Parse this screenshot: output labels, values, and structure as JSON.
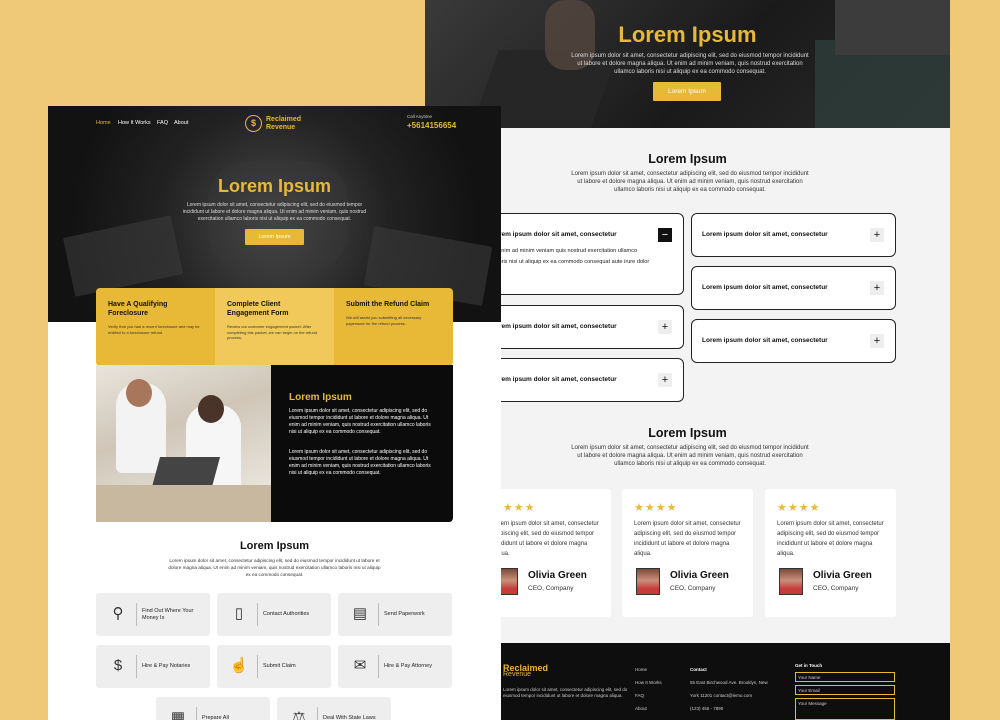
{
  "back": {
    "hero": {
      "title": "Lorem Ipsum",
      "text": "Lorem ipsum dolor sit amet, consectetur adipiscing elit, sed do eiusmod tempor incididunt ut labore et dolore magna aliqua. Ut enim ad minim veniam, quis nostrud exercitation ullamco laboris nisi ut aliquip ex ea commodo consequat.",
      "button": "Lorem Ipsum"
    },
    "faq_section": {
      "title": "Lorem Ipsum",
      "text": "Lorem ipsum dolor sit amet, consectetur adipiscing elit, sed do eiusmod tempor incididunt ut labore et dolore magna aliqua. Ut enim ad minim veniam, quis nostrud exercitation ullamco laboris nisi ut aliquip ex ea commodo consequat.",
      "items": [
        {
          "q": "Lorem ipsum dolor sit amet, consectetur",
          "toggle": "−",
          "answer": "Ut enim ad minim veniam quis nostrud exercitation ullamco laboris nisi ut aliquip ex ea commodo consequat aute irure dolor"
        },
        {
          "q": "Lorem ipsum dolor sit amet, consectetur",
          "toggle": "+"
        },
        {
          "q": "Lorem ipsum dolor sit amet, consectetur",
          "toggle": "+"
        },
        {
          "q": "Lorem ipsum dolor sit amet, consectetur",
          "toggle": "+"
        },
        {
          "q": "Lorem ipsum dolor sit amet, consectetur",
          "toggle": "+"
        },
        {
          "q": "Lorem ipsum dolor sit amet, consectetur",
          "toggle": "+"
        }
      ]
    },
    "testimonials": {
      "title": "Lorem Ipsum",
      "text": "Lorem ipsum dolor sit amet, consectetur adipiscing elit, sed do eiusmod tempor incididunt ut labore et dolore magna aliqua. Ut enim ad minim veniam, quis nostrud exercitation ullamco laboris nisi ut aliquip ex ea commodo consequat.",
      "stars": "★★★★",
      "cards": [
        {
          "text": "Lorem ipsum dolor sit amet, consectetur adipiscing elit, sed do eiusmod tempor incididunt ut labore et dolore magna aliqua.",
          "name": "Olivia Green",
          "role": "CEO, Company"
        },
        {
          "text": "Lorem ipsum dolor sit amet, consectetur adipiscing elit, sed do eiusmod tempor incididunt ut labore et dolore magna aliqua.",
          "name": "Olivia Green",
          "role": "CEO, Company"
        },
        {
          "text": "Lorem ipsum dolor sit amet, consectetur adipiscing elit, sed do eiusmod tempor incididunt ut labore et dolore magna aliqua.",
          "name": "Olivia Green",
          "role": "CEO, Company"
        }
      ]
    },
    "footer": {
      "brand_line1": "Reclaimed",
      "brand_line2": "Revenue",
      "text": "Lorem ipsum dolor sit amet, consectetur adipiscing elit, sed do eiusmod tempor incididunt ut labore et dolore magna aliqua.",
      "links": [
        "Home",
        "How It Works",
        "FAQ",
        "About"
      ],
      "contact_heading": "Contact",
      "address_line1": "55 East Birchwood Ave. Brooklyn, New",
      "address_line2": "York 11201 contact@lemo.com",
      "phone": "(123) 456 - 7890",
      "get_in_touch": "Get in Touch",
      "name_placeholder": "Your Name",
      "email_placeholder": "Your Email",
      "message_placeholder": "Your Message"
    }
  },
  "front": {
    "nav": [
      "Home",
      "How It Works",
      "FAQ",
      "About"
    ],
    "logo_line1": "Reclaimed",
    "logo_line2": "Revenue",
    "logo_mark": "$",
    "call_label": "Call Anytime",
    "call_number": "+5614156654",
    "hero": {
      "title": "Lorem Ipsum",
      "text": "Lorem ipsum dolor sit amet, consectetur adipiscing elit, sed do eiusmod tempor incididunt ut labore et dolore magna aliqua. Ut enim ad minim veniam, quis nostrud exercitation ullamco laboris nisi ut aliquip ex ea commodo consequat.",
      "button": "Lorem Ipsum"
    },
    "steps": [
      {
        "title": "Have A Qualifying Foreclosure",
        "text": "Verify that you had a recent foreclosure and may be entitled to a foreclosure refund."
      },
      {
        "title": "Complete Client Engagement Form",
        "text": "Review our customer engagement packet. After completing this packet, we can begin on the refund process."
      },
      {
        "title": "Submit the Refund Claim",
        "text": "We will assist you submitting all necessary paperwork for the refund process."
      }
    ],
    "about": {
      "title": "Lorem Ipsum",
      "p1": "Lorem ipsum dolor sit amet, consectetur adipiscing elit, sed do eiusmod tempor incididunt ut labore et dolore magna aliqua. Ut enim ad minim veniam, quis nostrud exercitation ullamco laboris nisi ut aliquip ex ea commodo consequat.",
      "p2": "Lorem ipsum dolor sit amet, consectetur adipiscing elit, sed do eiusmod tempor incididunt ut labore et dolore magna aliqua. Ut enim ad minim veniam, quis nostrud exercitation ullamco laboris nisi ut aliquip ex ea commodo consequat."
    },
    "services": {
      "title": "Lorem Ipsum",
      "text": "Lorem ipsum dolor sit amet, consectetur adipiscing elit, sed do eiusmod tempor incididunt ut labore et dolore magna aliqua. Ut enim ad minim veniam, quis nostrud exercitation ullamco laboris nisi ut aliquip ex ea commodo consequat.",
      "items": [
        {
          "icon": "magnifier-icon",
          "glyph": "⚲",
          "label": "Find Out Where Your Money Is"
        },
        {
          "icon": "phone-icon",
          "glyph": "▯",
          "label": "Contact Authorities"
        },
        {
          "icon": "document-icon",
          "glyph": "▤",
          "label": "Send Paperwork"
        },
        {
          "icon": "money-hand-icon",
          "glyph": "$",
          "label": "Hire & Pay Notaries"
        },
        {
          "icon": "claim-hand-icon",
          "glyph": "☝",
          "label": "Submit Claim"
        },
        {
          "icon": "certificate-icon",
          "glyph": "✉",
          "label": "Hire & Pay Attorney"
        },
        {
          "icon": "papers-icon",
          "glyph": "▦",
          "label": "Prepare All"
        },
        {
          "icon": "scales-icon",
          "glyph": "⚖",
          "label": "Deal With State Laws"
        }
      ]
    }
  },
  "colors": {
    "background": "#efc977",
    "accent": "#e8b936",
    "dark": "#0b0b0b"
  }
}
